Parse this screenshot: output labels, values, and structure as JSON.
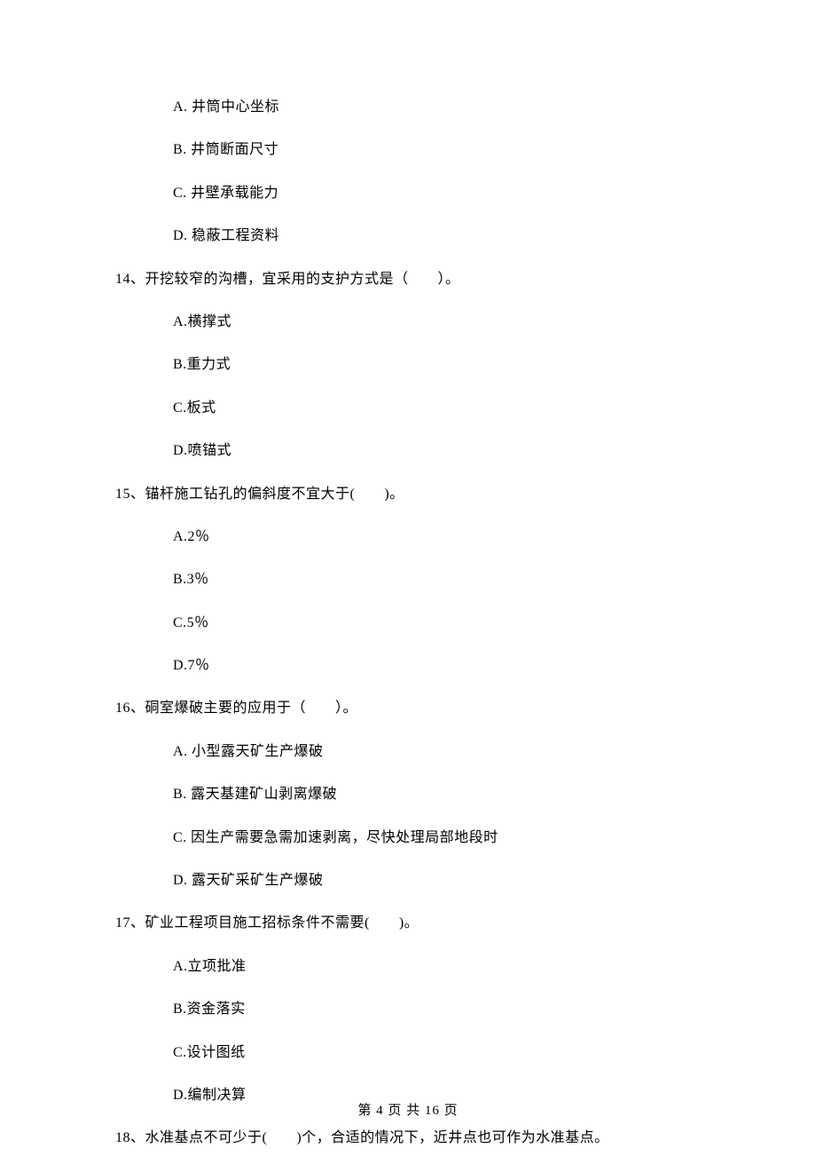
{
  "preOptions": [
    "A.  井筒中心坐标",
    "B.  井筒断面尺寸",
    "C.  井壁承载能力",
    "D.  稳蔽工程资料"
  ],
  "questions": [
    {
      "num": "14、",
      "text": "开挖较窄的沟槽，宜采用的支护方式是（　　）。",
      "options": [
        "A.横撑式",
        "B.重力式",
        "C.板式",
        "D.喷锚式"
      ]
    },
    {
      "num": "15、",
      "text": "锚杆施工钻孔的偏斜度不宜大于(　　)。",
      "options": [
        "A.2％",
        "B.3％",
        "C.5％",
        "D.7％"
      ]
    },
    {
      "num": "16、",
      "text": "硐室爆破主要的应用于（　　）。",
      "options": [
        "A.  小型露天矿生产爆破",
        "B.  露天基建矿山剥离爆破",
        "C.  因生产需要急需加速剥离，尽快处理局部地段时",
        "D.  露天矿采矿生产爆破"
      ]
    },
    {
      "num": "17、",
      "text": "矿业工程项目施工招标条件不需要(　　)。",
      "options": [
        "A.立项批准",
        "B.资金落实",
        "C.设计图纸",
        "D.编制决算"
      ]
    },
    {
      "num": "18、",
      "text": "水准基点不可少于(　　)个，合适的情况下，近井点也可作为水准基点。",
      "options": []
    }
  ],
  "footer": "第 4 页 共 16 页"
}
